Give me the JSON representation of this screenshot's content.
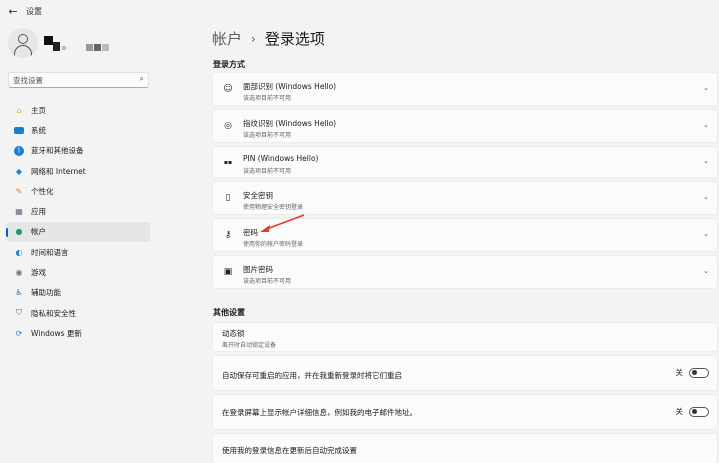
{
  "window": {
    "title": "设置",
    "back_icon": "back-arrow-icon"
  },
  "search": {
    "placeholder": "查找设置",
    "icon": "search-icon"
  },
  "sidebar": {
    "items": [
      {
        "label": "主页",
        "icon": "home-icon",
        "color": "#e8a33d"
      },
      {
        "label": "系统",
        "icon": "monitor-icon",
        "color": "#1a7fd4"
      },
      {
        "label": "蓝牙和其他设备",
        "icon": "bluetooth-icon",
        "color": "#1a7fd4"
      },
      {
        "label": "网络和 Internet",
        "icon": "wifi-icon",
        "color": "#1a7fd4"
      },
      {
        "label": "个性化",
        "icon": "brush-icon",
        "color": "#d67a2b"
      },
      {
        "label": "应用",
        "icon": "apps-icon",
        "color": "#5a6b80"
      },
      {
        "label": "帐户",
        "icon": "account-icon",
        "color": "#1f9a6b",
        "active": true
      },
      {
        "label": "时间和语言",
        "icon": "globe-clock-icon",
        "color": "#1a7fd4"
      },
      {
        "label": "游戏",
        "icon": "gamepad-icon",
        "color": "#6b7785"
      },
      {
        "label": "辅助功能",
        "icon": "accessibility-icon",
        "color": "#1a5fa8"
      },
      {
        "label": "隐私和安全性",
        "icon": "shield-icon",
        "color": "#5a6b80"
      },
      {
        "label": "Windows 更新",
        "icon": "update-icon",
        "color": "#1a7fd4"
      }
    ]
  },
  "breadcrumb": {
    "parent": "帐户",
    "separator": "›",
    "current": "登录选项"
  },
  "sign_in_section": {
    "label": "登录方式",
    "items": [
      {
        "title": "面部识别 (Windows Hello)",
        "subtitle": "该选项目前不可用",
        "icon": "face-icon"
      },
      {
        "title": "指纹识别 (Windows Hello)",
        "subtitle": "该选项目前不可用",
        "icon": "fingerprint-icon"
      },
      {
        "title": "PIN (Windows Hello)",
        "subtitle": "该选项目前不可用",
        "icon": "pin-icon"
      },
      {
        "title": "安全密钥",
        "subtitle": "使用物理安全密钥登录",
        "icon": "usb-key-icon"
      },
      {
        "title": "密码",
        "subtitle": "使用你的帐户密码登录",
        "icon": "key-icon"
      },
      {
        "title": "图片密码",
        "subtitle": "该选项目前不可用",
        "icon": "picture-icon"
      }
    ]
  },
  "other_section": {
    "label": "其他设置",
    "dynamic_lock": {
      "title": "动态锁",
      "subtitle": "离开时自动锁定设备"
    },
    "toggles": [
      {
        "title": "自动保存可重启的应用，并在我重新登录时将它们重启",
        "state_label": "关",
        "on": false
      },
      {
        "title": "在登录屏幕上显示帐户详细信息，例如我的电子邮件地址。",
        "state_label": "关",
        "on": false
      }
    ],
    "last_item": {
      "title": "使用我的登录信息在更新后自动完成设置"
    }
  },
  "annotation": {
    "color": "#e53935",
    "icon": "red-arrow-pointer"
  }
}
